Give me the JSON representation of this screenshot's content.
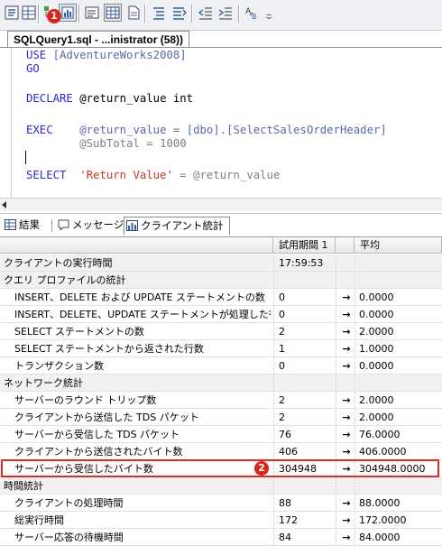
{
  "toolbar": {
    "buttons": [
      {
        "icon": "query-text-icon"
      },
      {
        "icon": "query-grid-icon"
      },
      {
        "icon": "execution-plan-icon"
      },
      {
        "icon": "client-statistics-icon",
        "active": true
      },
      {
        "icon": "results-to-text-icon"
      },
      {
        "icon": "results-to-grid-icon"
      },
      {
        "icon": "results-to-file-icon"
      },
      {
        "icon": "comment-icon"
      },
      {
        "icon": "uncomment-icon"
      },
      {
        "icon": "decrease-indent-icon"
      },
      {
        "icon": "increase-indent-icon"
      },
      {
        "icon": "specify-values-icon"
      },
      {
        "icon": "toolbar-options-icon"
      }
    ],
    "callout": "1"
  },
  "editor": {
    "tab_title": "SQLQuery1.sql - ...inistrator (58))",
    "lines": [
      {
        "kw": "USE",
        "rest": " [AdventureWorks2008]"
      },
      {
        "kw": "GO",
        "rest": ""
      },
      {
        "kw": "DECLARE",
        "rest": " @return_value int"
      },
      {
        "kw": "EXEC",
        "rest": "    @return_value = [dbo].[SelectSalesOrderHeader]"
      },
      {
        "kw": "",
        "rest": "        @SubTotal = 1000"
      },
      {
        "kw": "SELECT",
        "str": "  'Return Value'",
        "rest": " = @return_value"
      }
    ]
  },
  "results": {
    "tabs": [
      {
        "label": "結果",
        "icon": "grid-icon"
      },
      {
        "label": "メッセージ",
        "icon": "messages-icon"
      },
      {
        "label": "クライアント統計",
        "icon": "client-statistics-icon",
        "active": true
      }
    ],
    "columns": [
      "",
      "試用期間 1",
      "",
      "平均"
    ],
    "rows": [
      {
        "type": "cat",
        "label": "クライアントの実行時間",
        "trial": "17:59:53",
        "arrow": "",
        "avg": ""
      },
      {
        "type": "cat",
        "label": "クエリ プロファイルの統計",
        "trial": "",
        "arrow": "",
        "avg": ""
      },
      {
        "type": "item",
        "label": "INSERT、DELETE および UPDATE ステートメントの数",
        "trial": "0",
        "arrow": "→",
        "avg": "0.0000"
      },
      {
        "type": "item",
        "label": "INSERT、DELETE、UPDATE ステートメントが処理した行...",
        "trial": "0",
        "arrow": "→",
        "avg": "0.0000"
      },
      {
        "type": "item",
        "label": "SELECT ステートメントの数",
        "trial": "2",
        "arrow": "→",
        "avg": "2.0000"
      },
      {
        "type": "item",
        "label": "SELECT ステートメントから返された行数",
        "trial": "1",
        "arrow": "→",
        "avg": "1.0000"
      },
      {
        "type": "item",
        "label": "トランザクション数",
        "trial": "0",
        "arrow": "→",
        "avg": "0.0000"
      },
      {
        "type": "cat",
        "label": "ネットワーク統計",
        "trial": "",
        "arrow": "",
        "avg": ""
      },
      {
        "type": "item",
        "label": "サーバーのラウンド トリップ数",
        "trial": "2",
        "arrow": "→",
        "avg": "2.0000"
      },
      {
        "type": "item",
        "label": "クライアントから送信した TDS パケット",
        "trial": "2",
        "arrow": "→",
        "avg": "2.0000"
      },
      {
        "type": "item",
        "label": "サーバーから受信した TDS パケット",
        "trial": "76",
        "arrow": "→",
        "avg": "76.0000"
      },
      {
        "type": "item",
        "label": "クライアントから送信されたバイト数",
        "trial": "406",
        "arrow": "→",
        "avg": "406.0000"
      },
      {
        "type": "item",
        "label": "サーバーから受信したバイト数",
        "trial": "304948",
        "arrow": "→",
        "avg": "304948.0000",
        "highlight": true
      },
      {
        "type": "cat",
        "label": "時間統計",
        "trial": "",
        "arrow": "",
        "avg": ""
      },
      {
        "type": "item",
        "label": "クライアントの処理時間",
        "trial": "88",
        "arrow": "→",
        "avg": "88.0000"
      },
      {
        "type": "item",
        "label": "総実行時間",
        "trial": "172",
        "arrow": "→",
        "avg": "172.0000"
      },
      {
        "type": "item",
        "label": "サーバー応答の待機時間",
        "trial": "84",
        "arrow": "→",
        "avg": "84.0000"
      }
    ],
    "callout": "2"
  },
  "colors": {
    "highlight": "#e12a24",
    "keyword": "#2b2bd6",
    "string": "#c8352a",
    "callout": "#d9261c"
  }
}
